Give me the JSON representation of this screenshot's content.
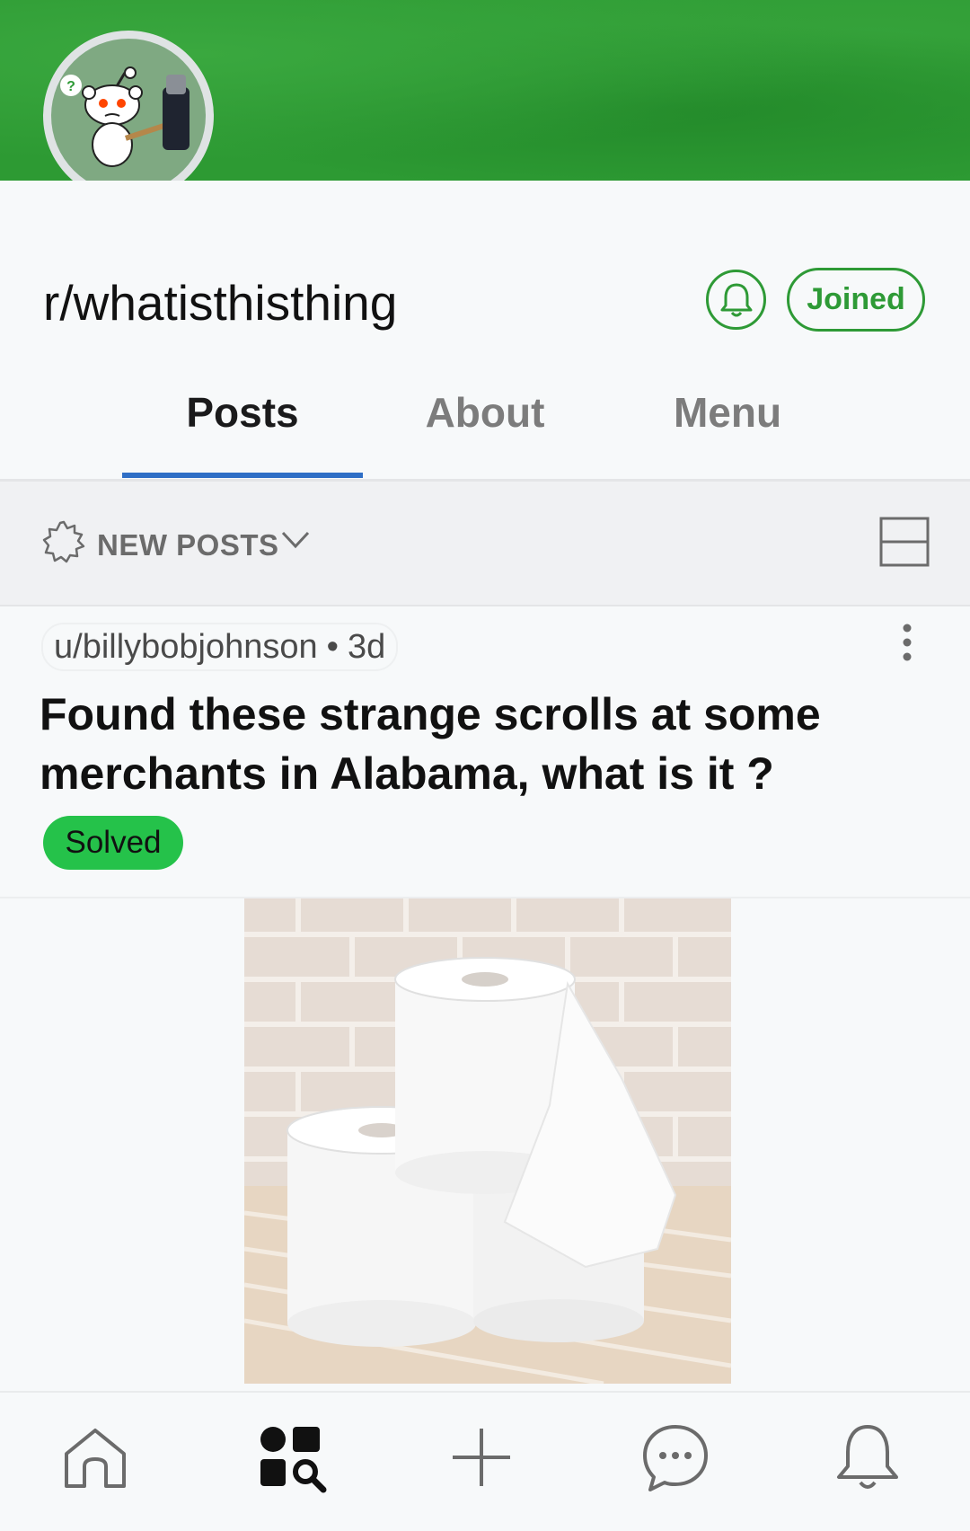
{
  "subreddit": {
    "name": "r/whatisthisthing",
    "joined_label": "Joined",
    "accent_color": "#2e9a36",
    "banner_color": "#2d9a33"
  },
  "tabs": [
    {
      "label": "Posts",
      "active": true
    },
    {
      "label": "About",
      "active": false
    },
    {
      "label": "Menu",
      "active": false
    }
  ],
  "sort": {
    "label": "NEW POSTS",
    "icon": "sparkle-burst-icon",
    "layout_icon": "card-view-icon"
  },
  "post": {
    "author": "u/billybobjohnson",
    "separator": "•",
    "age": "3d",
    "title": "Found these strange scrolls at some merchants in Alabama, what is it ?",
    "flair": "Solved",
    "flair_color": "#25c24a",
    "image_icon": "toilet-paper-rolls-image"
  },
  "bottom_nav": [
    {
      "name": "home",
      "icon": "home-icon"
    },
    {
      "name": "discover",
      "icon": "discover-icon"
    },
    {
      "name": "create",
      "icon": "plus-icon"
    },
    {
      "name": "chat",
      "icon": "chat-icon"
    },
    {
      "name": "inbox",
      "icon": "bell-icon"
    }
  ]
}
